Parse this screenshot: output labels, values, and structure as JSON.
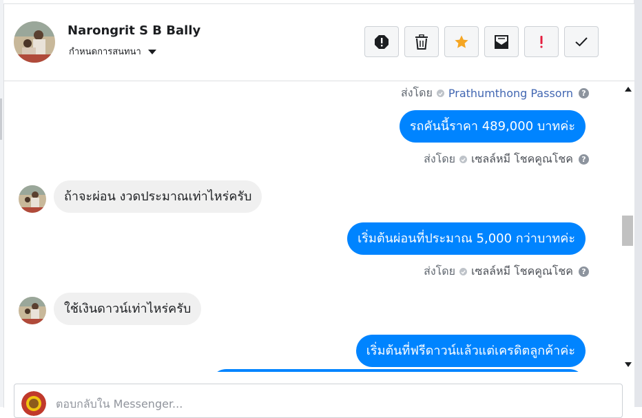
{
  "header": {
    "contact_name": "Narongrit S B Bally",
    "settings_label": "กำหนดการสนทนา",
    "toolbar": [
      {
        "icon": "report-icon",
        "name": "report-button"
      },
      {
        "icon": "trash-icon",
        "name": "delete-button"
      },
      {
        "icon": "star-icon",
        "name": "star-button"
      },
      {
        "icon": "mark-unread-icon",
        "name": "mark-unread-button"
      },
      {
        "icon": "exclamation-icon",
        "name": "mark-spam-button"
      },
      {
        "icon": "check-icon",
        "name": "mark-done-button"
      }
    ]
  },
  "messages": {
    "sent_by_prefix": "ส่งโดย",
    "sent_by_1": "Prathumthong Passorn",
    "bubble_1": "รถคันนี้ราคา 489,000 บาทค่ะ",
    "sent_by_2": "เซลล์หมี โชคคูณโชค",
    "incoming_1": "ถ้าจะผ่อน งวดประมาณเท่าไหร่ครับ",
    "bubble_2": "เริ่มต้นผ่อนที่ประมาณ 5,000 กว่าบาทค่ะ",
    "sent_by_3": "เซลล์หมี โชคคูณโชค",
    "incoming_2": "ใช้เงินดาวน์เท่าไหร่ครับ",
    "bubble_3": "เริ่มต้นที่ฟรีดาวน์แล้วแต่เครดิตลูกค้าค่ะ"
  },
  "reply": {
    "placeholder": "ตอบกลับใน Messenger..."
  },
  "colors": {
    "outgoing_bubble": "#0084ff",
    "incoming_bubble": "#f0f0f0",
    "star": "#f5a623",
    "spam": "#e41e3f"
  }
}
